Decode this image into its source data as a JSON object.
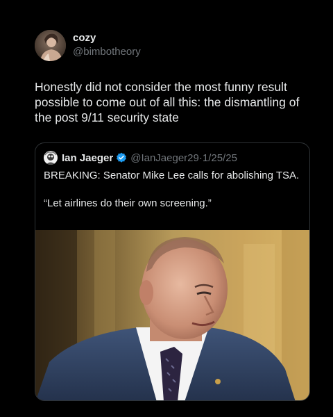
{
  "post": {
    "author": {
      "display_name": "cozy",
      "handle": "@bimbotheory",
      "avatar_icon": "user-avatar"
    },
    "text": "Honestly did not consider the most funny result possible to come out of all this: the dismantling of the post 9/11 security state"
  },
  "quoted_post": {
    "author": {
      "display_name": "Ian Jaeger",
      "verified": true,
      "handle": "@IanJaeger29",
      "separator": "·",
      "date": "1/25/25",
      "avatar_icon": "user-avatar"
    },
    "text_line1": "BREAKING: Senator Mike Lee calls for abolishing TSA.",
    "text_line2": "“Let airlines do their own screening.”",
    "media_icon": "photo"
  },
  "colors": {
    "background": "#000000",
    "text_primary": "#e7e9ea",
    "text_secondary": "#71767b",
    "border": "#2f3336",
    "verified_blue": "#1d9bf0"
  }
}
